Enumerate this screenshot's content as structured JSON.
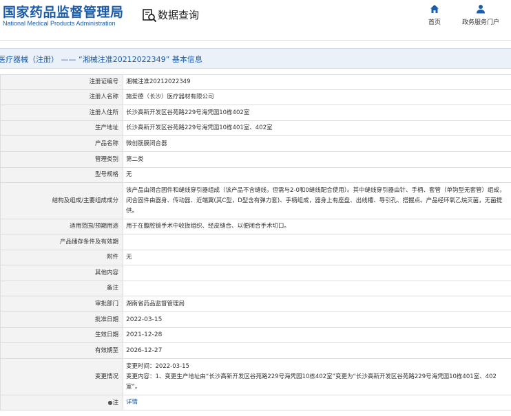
{
  "header": {
    "brand_cn": "国家药品监督管理局",
    "brand_en": "National Medical Products Administration",
    "query_label": "数据查询",
    "nav": {
      "home_label": "首页",
      "portal_label": "政务服务门户"
    }
  },
  "title": "医疗器械（注册） —— “湘械注准20212022349” 基本信息",
  "rows": [
    {
      "label": "注册证编号",
      "value": "湘械注准20212022349"
    },
    {
      "label": "注册人名称",
      "value": "施爱德（长沙）医疗器材有限公司"
    },
    {
      "label": "注册人住所",
      "value": "长沙高新开发区谷苑路229号海凭园10栋402室"
    },
    {
      "label": "生产地址",
      "value": "长沙高新开发区谷苑路229号海凭园10栋401室、402室"
    },
    {
      "label": "产品名称",
      "value": "微创筋膜闭合器"
    },
    {
      "label": "管理类别",
      "value": "第二类"
    },
    {
      "label": "型号规格",
      "value": "无"
    },
    {
      "label": "结构及组成/主要组成成分",
      "value": "该产品由闭合固件和缝线穿引器组成（该产品不含缝线，但需与2-0和0缝线配合使用）。其中缝线穿引器由针、手柄、套管（单钩型无套管）组成，闭合固件由器身、传动器、近端翼(其C型，D型含有弹力套)、手柄组成，器身上有座盘、出线槽、导引孔、搭握点。产品经环氧乙烷灭菌，无菌提供。"
    },
    {
      "label": "适用范围/预期用途",
      "value": "用于在腹腔镜手术中收拢组织、经皮缝合、以便闭合手术切口。"
    },
    {
      "label": "产品储存条件及有效期",
      "value": ""
    },
    {
      "label": "附件",
      "value": "无"
    },
    {
      "label": "其他内容",
      "value": ""
    },
    {
      "label": "备注",
      "value": ""
    },
    {
      "label": "审批部门",
      "value": "湖南省药品监督管理局"
    },
    {
      "label": "批准日期",
      "value": "2022-03-15"
    },
    {
      "label": "生效日期",
      "value": "2021-12-28"
    },
    {
      "label": "有效期至",
      "value": "2026-12-27"
    },
    {
      "label": "变更情况",
      "value_line1": "变更时间：2022-03-15",
      "value_line2": "变更内容：1、变更生产地址由“长沙高新开发区谷苑路229号海凭园10栋402室”变更为“长沙高新开发区谷苑路229号海凭园10栋401室、402室”。"
    },
    {
      "label": "注",
      "value": "详情"
    }
  ],
  "colors": {
    "brand_blue": "#1b5ca8",
    "label_bg": "#f3f3f3",
    "title_bg": "#eaf1f9",
    "border": "#dcdcdc"
  },
  "icons": {
    "query": "search-document-icon",
    "home": "home-icon",
    "portal": "user-icon",
    "note": "bullet-icon"
  }
}
